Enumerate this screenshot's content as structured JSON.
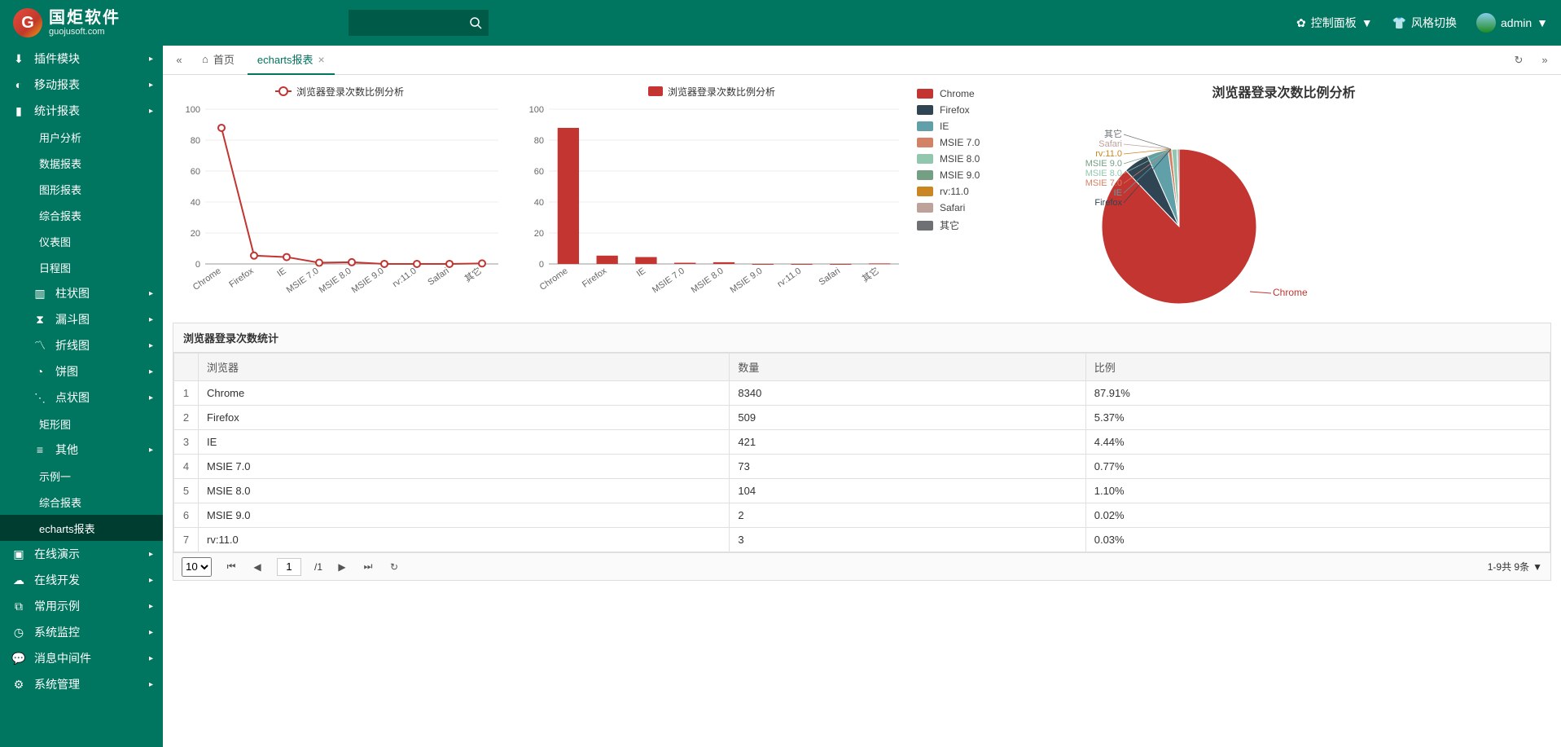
{
  "brand": {
    "cn": "国炬软件",
    "en": "guojusoft.com"
  },
  "top": {
    "control_panel": "控制面板",
    "style_switch": "风格切换",
    "user": "admin",
    "search_placeholder": ""
  },
  "tabs": {
    "home": "首页",
    "report": "echarts报表"
  },
  "sidebar": {
    "items": [
      {
        "icon": "download",
        "label": "插件模块",
        "arrow": true
      },
      {
        "icon": "pie",
        "label": "移动报表",
        "arrow": true
      },
      {
        "icon": "bar",
        "label": "统计报表",
        "arrow": true
      },
      {
        "sub": true,
        "label": "用户分析"
      },
      {
        "sub": true,
        "label": "数据报表"
      },
      {
        "sub": true,
        "label": "图形报表"
      },
      {
        "sub": true,
        "label": "综合报表"
      },
      {
        "sub": true,
        "label": "仪表图"
      },
      {
        "sub": true,
        "label": "日程图"
      },
      {
        "icon": "bar2",
        "label": "柱状图",
        "arrow": true,
        "lvl": "2b"
      },
      {
        "icon": "hourglass",
        "label": "漏斗图",
        "arrow": true,
        "lvl": "2b"
      },
      {
        "icon": "line",
        "label": "折线图",
        "arrow": true,
        "lvl": "2b"
      },
      {
        "icon": "pie2",
        "label": "饼图",
        "arrow": true,
        "lvl": "2b"
      },
      {
        "icon": "scatter",
        "label": "点状图",
        "arrow": true,
        "lvl": "2b"
      },
      {
        "sub": true,
        "label": "矩形图"
      },
      {
        "icon": "list",
        "label": "其他",
        "arrow": true,
        "lvl": "2b"
      },
      {
        "sub": true,
        "label": "示例一"
      },
      {
        "sub": true,
        "label": "综合报表"
      },
      {
        "sub": true,
        "label": "echarts报表",
        "active": true
      },
      {
        "icon": "display",
        "label": "在线演示",
        "arrow": true
      },
      {
        "icon": "cloud",
        "label": "在线开发",
        "arrow": true
      },
      {
        "icon": "monitor",
        "label": "常用示例",
        "arrow": true
      },
      {
        "icon": "dash",
        "label": "系统监控",
        "arrow": true
      },
      {
        "icon": "msg",
        "label": "消息中间件",
        "arrow": true
      },
      {
        "icon": "gear",
        "label": "系统管理",
        "arrow": true
      }
    ]
  },
  "chart_legend": {
    "line_title": "浏览器登录次数比例分析",
    "bar_title": "浏览器登录次数比例分析",
    "pie_title": "浏览器登录次数比例分析"
  },
  "table": {
    "title": "浏览器登录次数统计",
    "headers": [
      "浏览器",
      "数量",
      "比例"
    ],
    "rows": [
      {
        "i": "1",
        "browser": "Chrome",
        "count": "8340",
        "ratio": "87.91%"
      },
      {
        "i": "2",
        "browser": "Firefox",
        "count": "509",
        "ratio": "5.37%"
      },
      {
        "i": "3",
        "browser": "IE",
        "count": "421",
        "ratio": "4.44%"
      },
      {
        "i": "4",
        "browser": "MSIE 7.0",
        "count": "73",
        "ratio": "0.77%"
      },
      {
        "i": "5",
        "browser": "MSIE 8.0",
        "count": "104",
        "ratio": "1.10%"
      },
      {
        "i": "6",
        "browser": "MSIE 9.0",
        "count": "2",
        "ratio": "0.02%"
      },
      {
        "i": "7",
        "browser": "rv:11.0",
        "count": "3",
        "ratio": "0.03%"
      }
    ]
  },
  "pager": {
    "size": "10",
    "page": "1",
    "total_pages": "/1",
    "summary": "1-9共 9条"
  },
  "pie_legend": [
    {
      "label": "Chrome",
      "color": "#c23531"
    },
    {
      "label": "Firefox",
      "color": "#2f4554"
    },
    {
      "label": "IE",
      "color": "#61a0a8"
    },
    {
      "label": "MSIE 7.0",
      "color": "#d48265"
    },
    {
      "label": "MSIE 8.0",
      "color": "#91c7ae"
    },
    {
      "label": "MSIE 9.0",
      "color": "#749f83"
    },
    {
      "label": "rv:11.0",
      "color": "#ca8622"
    },
    {
      "label": "Safari",
      "color": "#bda29a"
    },
    {
      "label": "其它",
      "color": "#6e7074"
    }
  ],
  "chart_data": [
    {
      "type": "line",
      "title": "浏览器登录次数比例分析",
      "categories": [
        "Chrome",
        "Firefox",
        "IE",
        "MSIE 7.0",
        "MSIE 8.0",
        "MSIE 9.0",
        "rv:11.0",
        "Safari",
        "其它"
      ],
      "values": [
        87.91,
        5.37,
        4.44,
        0.77,
        1.1,
        0.02,
        0.03,
        0.03,
        0.34
      ],
      "ylabel": "",
      "ylim": [
        0,
        100
      ],
      "yticks": [
        0,
        20,
        40,
        60,
        80,
        100
      ]
    },
    {
      "type": "bar",
      "title": "浏览器登录次数比例分析",
      "categories": [
        "Chrome",
        "Firefox",
        "IE",
        "MSIE 7.0",
        "MSIE 8.0",
        "MSIE 9.0",
        "rv:11.0",
        "Safari",
        "其它"
      ],
      "values": [
        87.91,
        5.37,
        4.44,
        0.77,
        1.1,
        0.02,
        0.03,
        0.03,
        0.34
      ],
      "ylabel": "",
      "ylim": [
        0,
        100
      ],
      "yticks": [
        0,
        20,
        40,
        60,
        80,
        100
      ]
    },
    {
      "type": "pie",
      "title": "浏览器登录次数比例分析",
      "series": [
        {
          "name": "Chrome",
          "value": 87.91,
          "color": "#c23531"
        },
        {
          "name": "Firefox",
          "value": 5.37,
          "color": "#2f4554"
        },
        {
          "name": "IE",
          "value": 4.44,
          "color": "#61a0a8"
        },
        {
          "name": "MSIE 7.0",
          "value": 0.77,
          "color": "#d48265"
        },
        {
          "name": "MSIE 8.0",
          "value": 1.1,
          "color": "#91c7ae"
        },
        {
          "name": "MSIE 9.0",
          "value": 0.02,
          "color": "#749f83"
        },
        {
          "name": "rv:11.0",
          "value": 0.03,
          "color": "#ca8622"
        },
        {
          "name": "Safari",
          "value": 0.03,
          "color": "#bda29a"
        },
        {
          "name": "其它",
          "value": 0.34,
          "color": "#6e7074"
        }
      ]
    }
  ]
}
